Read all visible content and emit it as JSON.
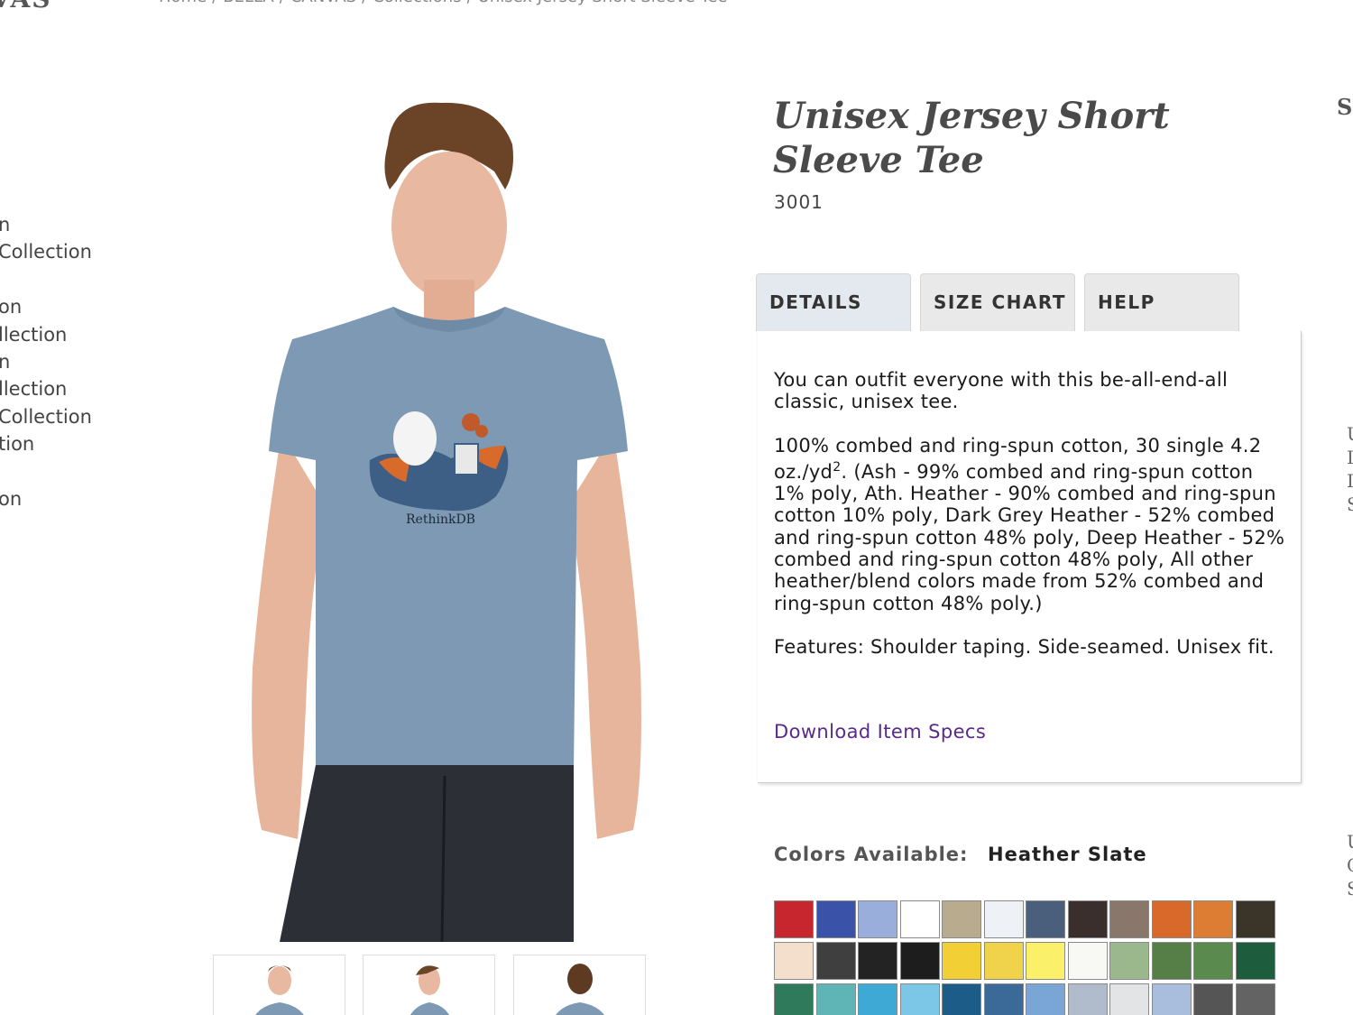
{
  "header": {
    "logo": "VAS",
    "breadcrumb": [
      "Home",
      "/",
      "BELLA",
      "/",
      "CANVAS",
      "/",
      "Collections",
      "/",
      "Unisex Jersey Short Sleeve Tee"
    ]
  },
  "sidenav": {
    "items": [
      "n",
      "Collection",
      "",
      "on",
      "llection",
      "n",
      "llection",
      "Collection",
      "tion",
      "",
      "on",
      ""
    ]
  },
  "product": {
    "title": "Unisex Jersey Short Sleeve Tee",
    "sku": "3001",
    "print_label": "RethinkDB",
    "edge_heading": "SI"
  },
  "tabs": [
    {
      "label": "DETAILS",
      "active": true
    },
    {
      "label": "SIZE CHART",
      "active": false
    },
    {
      "label": "HELP",
      "active": false
    }
  ],
  "details": {
    "p1": "You can outfit everyone with this be-all-end-all classic, unisex tee.",
    "p2_a": "100% combed and ring-spun cotton, 30 single 4.2 oz./yd",
    "p2_sup": "2",
    "p2_b": ". (Ash - 99% combed and ring-spun cotton 1% poly, Ath. Heather - 90% combed and ring-spun cotton 10% poly, Dark Grey Heather - 52% combed and ring-spun cotton 48% poly, Deep Heather - 52% combed and ring-spun cotton 48% poly, All other heather/blend colors made from 52% combed and ring-spun cotton 48% poly.)",
    "p3": "Features: Shoulder taping. Side-seamed. Unisex fit.",
    "link": "Download Item Specs"
  },
  "colors": {
    "label": "Colors Available:",
    "selected": "Heather Slate",
    "swatches": [
      "#c8262e",
      "#3a52a8",
      "#9aaedb",
      "#ffffff",
      "#b9ab8e",
      "#eef1f5",
      "#4a5f7c",
      "#3a2f2c",
      "#8a776b",
      "#d8692a",
      "#dc7d33",
      "#3b3428",
      "#f3dfcb",
      "#3f3f3f",
      "#232323",
      "#1d1d1d",
      "#f2cf35",
      "#f0d24b",
      "#faf06a",
      "#f8f8f4",
      "#9bb88c",
      "#567f47",
      "#5a8a4e",
      "#1e5c3e",
      "#2f7a5a",
      "#5fb5b5",
      "#3fa9d6",
      "#7cc6e8",
      "#1b5c88",
      "#3c6a98",
      "#7aa6d6",
      "#b0bccb",
      "#e3e4e6",
      "#a8bedc",
      "#555555",
      "#636363"
    ]
  },
  "edge_text": [
    "U",
    "I",
    "I",
    "S",
    "U",
    "C",
    "S"
  ]
}
